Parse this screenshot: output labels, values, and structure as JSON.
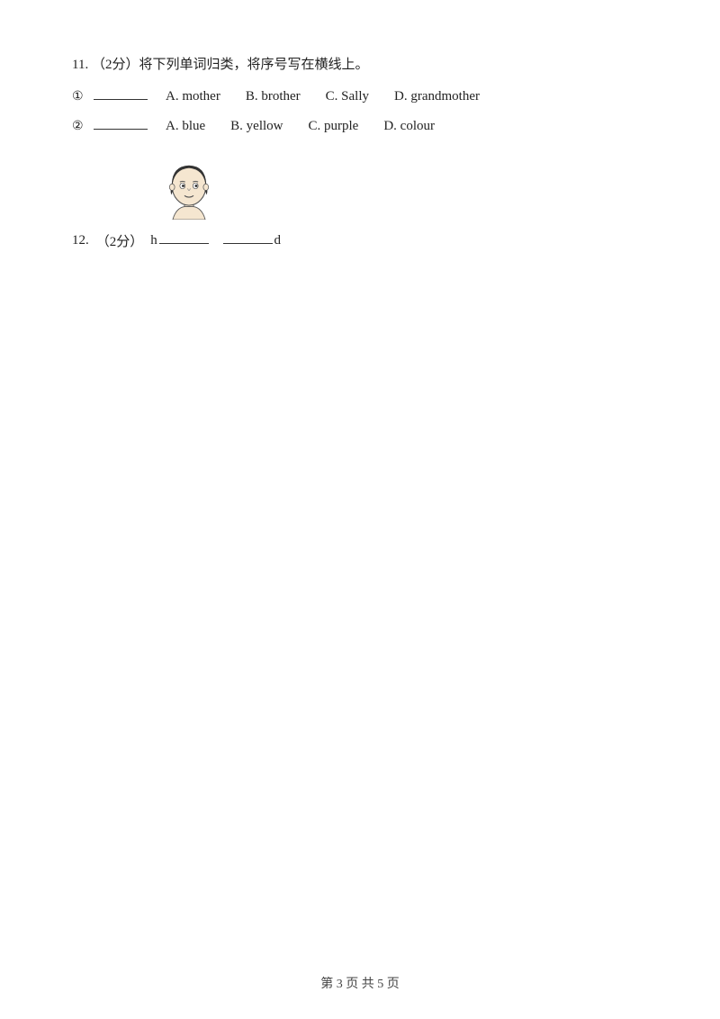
{
  "question11": {
    "number": "11.",
    "points": "（2分）将下列单词归类，将序号写在横线上。",
    "row1": {
      "circle": "①",
      "options": [
        {
          "label": "A.",
          "word": "mother"
        },
        {
          "label": "B.",
          "word": "brother"
        },
        {
          "label": "C.",
          "word": "Sally"
        },
        {
          "label": "D.",
          "word": "grandmother"
        }
      ]
    },
    "row2": {
      "circle": "②",
      "options": [
        {
          "label": "A.",
          "word": "blue"
        },
        {
          "label": "B.",
          "word": "yellow"
        },
        {
          "label": "C.",
          "word": "purple"
        },
        {
          "label": "D.",
          "word": "colour"
        }
      ]
    }
  },
  "question12": {
    "number": "12.",
    "points": "（2分）",
    "prefix": "h",
    "suffix": "d"
  },
  "footer": {
    "text": "第 3 页 共 5 页"
  }
}
